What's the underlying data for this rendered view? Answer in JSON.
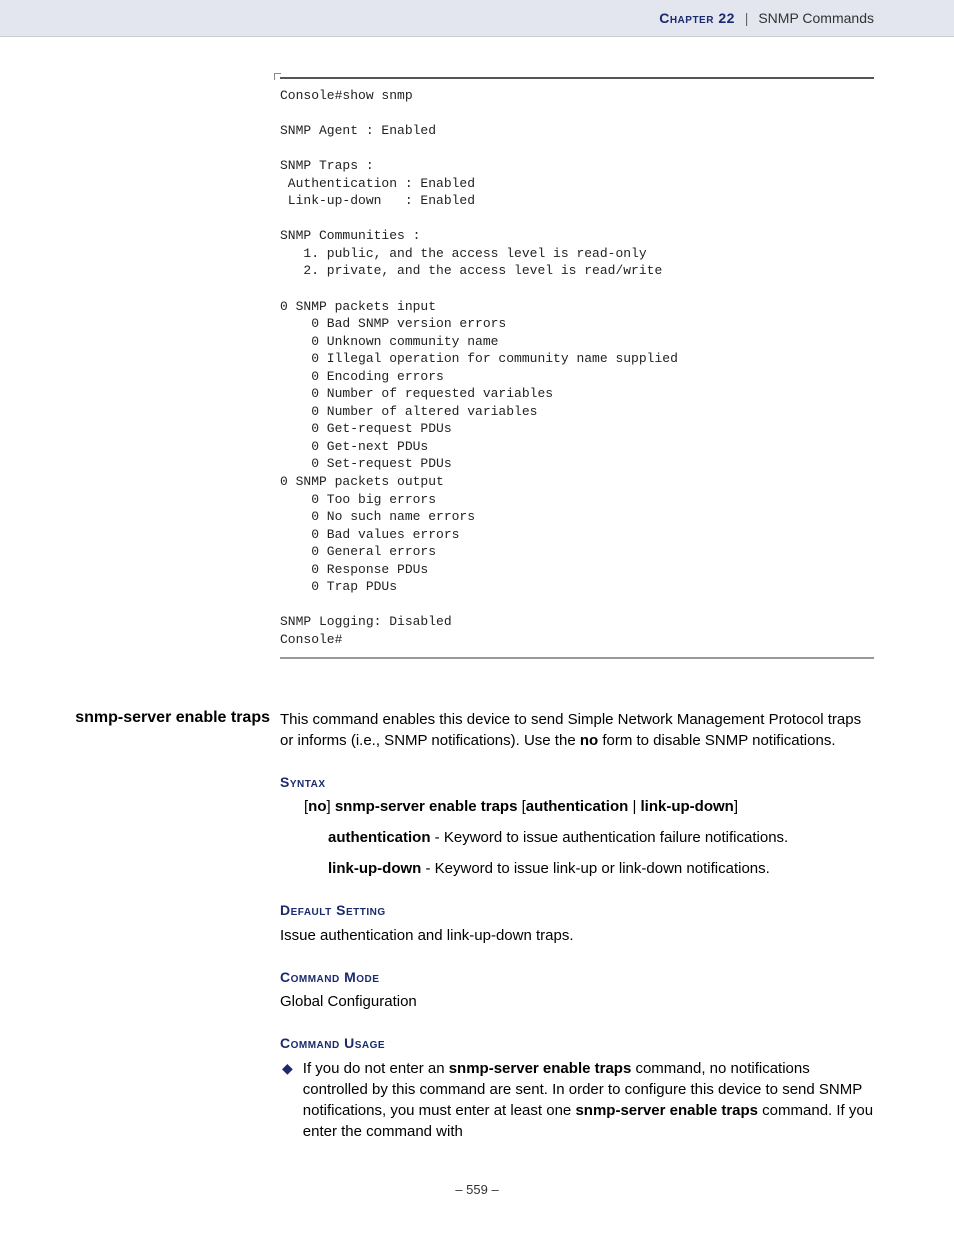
{
  "header": {
    "chapter": "Chapter 22",
    "separator": "|",
    "title": "SNMP Commands"
  },
  "console_output": "Console#show snmp\n\nSNMP Agent : Enabled\n\nSNMP Traps :\n Authentication : Enabled\n Link-up-down   : Enabled\n\nSNMP Communities :\n   1. public, and the access level is read-only\n   2. private, and the access level is read/write\n\n0 SNMP packets input\n    0 Bad SNMP version errors\n    0 Unknown community name\n    0 Illegal operation for community name supplied\n    0 Encoding errors\n    0 Number of requested variables\n    0 Number of altered variables\n    0 Get-request PDUs\n    0 Get-next PDUs\n    0 Set-request PDUs\n0 SNMP packets output\n    0 Too big errors\n    0 No such name errors\n    0 Bad values errors\n    0 General errors\n    0 Response PDUs\n    0 Trap PDUs\n\nSNMP Logging: Disabled\nConsole#",
  "command": {
    "name": "snmp-server enable traps",
    "description_pre": "This command enables this device to send Simple Network Management Protocol traps or informs (i.e., SNMP notifications). Use the ",
    "description_bold": "no",
    "description_post": " form to disable SNMP notifications.",
    "syntax_heading": "Syntax",
    "syntax_parts": {
      "p1": "[",
      "p2": "no",
      "p3": "] ",
      "p4": "snmp-server enable traps",
      "p5": " [",
      "p6": "authentication",
      "p7": " | ",
      "p8": "link-up-down",
      "p9": "]"
    },
    "params": {
      "auth_name": "authentication",
      "auth_desc": " - Keyword to issue authentication failure notifications.",
      "link_name": "link-up-down",
      "link_desc": " - Keyword to issue link-up or link-down notifications."
    },
    "default_heading": "Default Setting",
    "default_text": "Issue authentication and link-up-down traps.",
    "mode_heading": "Command Mode",
    "mode_text": "Global Configuration",
    "usage_heading": "Command Usage",
    "usage_bullet": {
      "pre": "If you do not enter an ",
      "b1": "snmp-server enable traps",
      "mid": " command, no notifications controlled by this command are sent. In order to configure this device to send SNMP notifications, you must enter at least one ",
      "b2": "snmp-server enable traps",
      "post": " command. If you enter the command with"
    }
  },
  "footer": {
    "page": "– 559 –"
  }
}
